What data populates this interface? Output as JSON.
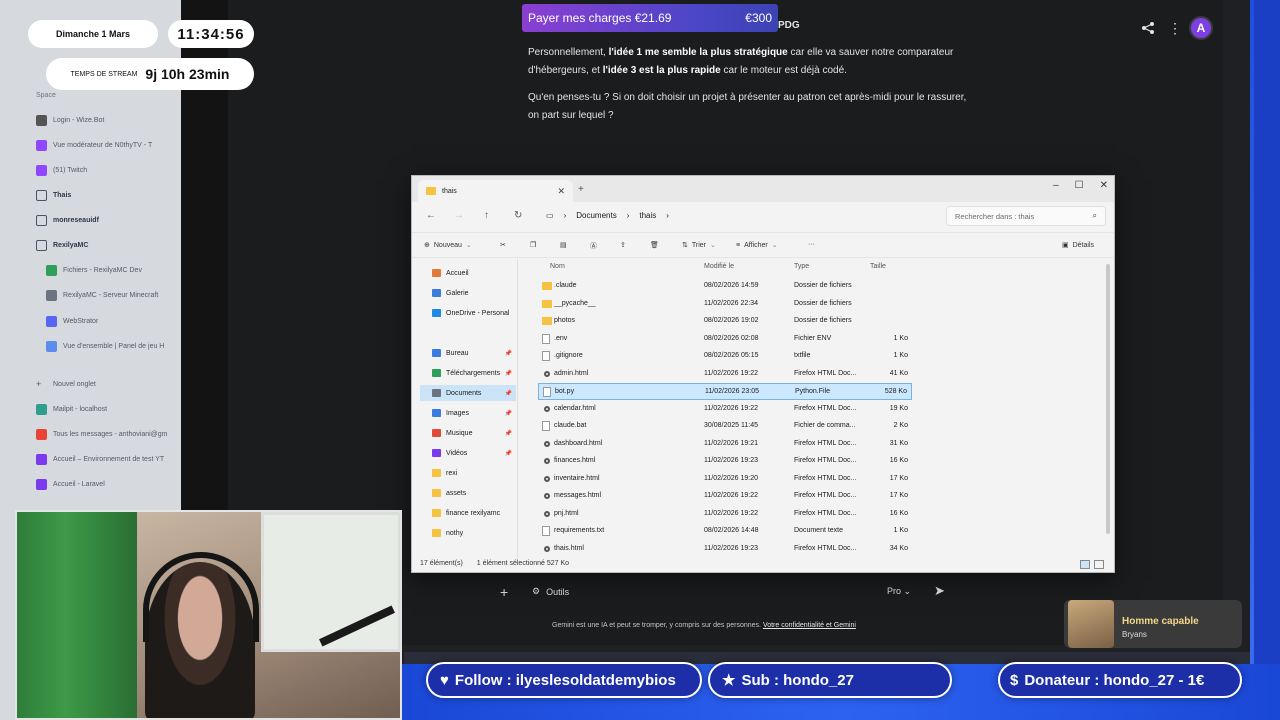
{
  "overlay": {
    "date": "Dimanche 1 Mars",
    "time": "11:34:56",
    "stream_label": "TEMPS DE STREAM",
    "stream_value": "9j 10h 23min",
    "follow": "Follow : ilyeslesoldatdemybios",
    "sub": "Sub : hondo_27",
    "donateur": "Donateur : hondo_27 - 1€",
    "alert_title": "Homme capable",
    "alert_user": "Bryans"
  },
  "donation": {
    "label": "Payer mes charges €21.69",
    "goal": "€300"
  },
  "sidebar": {
    "space_label": "Space",
    "items": [
      {
        "label": "Login - Wize.Bot",
        "color": "#555555"
      },
      {
        "label": "Vue modérateur de N0thyTV - T",
        "color": "#9146ff"
      },
      {
        "label": "(51) Twitch",
        "color": "#9146ff"
      },
      {
        "label": "Thais",
        "color": ""
      },
      {
        "label": "monreseauidf",
        "color": ""
      },
      {
        "label": "RexilyaMC",
        "color": ""
      },
      {
        "label": "Fichiers - RexilyaMC Dev",
        "color": "#2e9e58"
      },
      {
        "label": "RexilyaMC - Serveur Minecraft",
        "color": "#6b7280"
      },
      {
        "label": "WebStrator",
        "color": "#5865f2"
      },
      {
        "label": "Vue d'ensemble | Panel de jeu H",
        "color": "#5b8def"
      },
      {
        "label": "Nouvel onglet",
        "color": ""
      },
      {
        "label": "Mailpit - localhost",
        "color": "#2f9e8f"
      },
      {
        "label": "Tous les messages - anthoviani@gm",
        "color": "#ea4335"
      },
      {
        "label": "Accueil – Environnement de test YT",
        "color": "#7c3aed"
      },
      {
        "label": "Accueil - Laravel",
        "color": "#7c3aed"
      }
    ]
  },
  "gemini": {
    "header_suffix": "PDG",
    "paragraph1_pre": "Personnellement, ",
    "paragraph1_b1": "l'idée 1 me semble la plus stratégique",
    "paragraph1_mid": " car elle va sauver notre comparateur d'hébergeurs, et ",
    "paragraph1_b2": "l'idée 3 est la plus rapide",
    "paragraph1_post": " car le moteur est déjà codé.",
    "paragraph2": "Qu'en penses-tu ? Si on doit choisir un projet à présenter au patron cet après-midi pour le rassurer, on part sur lequel ?",
    "tools_label": "Outils",
    "mode_label": "Pro",
    "avatar_letter": "A",
    "disclaimer_pre": "Gemini est une IA et peut se tromper, y compris sur des personnes. ",
    "disclaimer_link": "Votre confidentialité et Gemini"
  },
  "explorer": {
    "tab_title": "thais",
    "breadcrumb": [
      "Documents",
      "thais"
    ],
    "search_placeholder": "Rechercher dans : thais",
    "toolbar": {
      "new": "Nouveau",
      "sort": "Trier",
      "view": "Afficher",
      "details": "Détails"
    },
    "nav": [
      {
        "label": "Accueil",
        "color": "#e07a3a"
      },
      {
        "label": "Galerie",
        "color": "#3a7be0"
      },
      {
        "label": "OneDrive - Personal",
        "color": "#1e88e5"
      },
      {
        "label": "Bureau",
        "color": "#3a7be0"
      },
      {
        "label": "Téléchargements",
        "color": "#2e9e58"
      },
      {
        "label": "Documents",
        "color": "#6b7280"
      },
      {
        "label": "Images",
        "color": "#3a7be0"
      },
      {
        "label": "Musique",
        "color": "#e04a3a"
      },
      {
        "label": "Vidéos",
        "color": "#7c3aed"
      },
      {
        "label": "rexi",
        "color": "#f5c242"
      },
      {
        "label": "assets",
        "color": "#f5c242"
      },
      {
        "label": "finance rexilyamc",
        "color": "#f5c242"
      },
      {
        "label": "nothy",
        "color": "#f5c242"
      }
    ],
    "columns": {
      "name": "Nom",
      "modified": "Modifié le",
      "type": "Type",
      "size": "Taille"
    },
    "files": [
      {
        "name": ".claude",
        "modified": "08/02/2026 14:59",
        "type": "Dossier de fichiers",
        "size": "",
        "kind": "folder"
      },
      {
        "name": "__pycache__",
        "modified": "11/02/2026 22:34",
        "type": "Dossier de fichiers",
        "size": "",
        "kind": "folder"
      },
      {
        "name": "photos",
        "modified": "08/02/2026 19:02",
        "type": "Dossier de fichiers",
        "size": "",
        "kind": "folder"
      },
      {
        "name": ".env",
        "modified": "08/02/2026 02:08",
        "type": "Fichier ENV",
        "size": "1 Ko",
        "kind": "file"
      },
      {
        "name": ".gitignore",
        "modified": "08/02/2026 05:15",
        "type": "txtfile",
        "size": "1 Ko",
        "kind": "file"
      },
      {
        "name": "admin.html",
        "modified": "11/02/2026 19:22",
        "type": "Firefox HTML Doc...",
        "size": "41 Ko",
        "kind": "html"
      },
      {
        "name": "bot.py",
        "modified": "11/02/2026 23:05",
        "type": "Python.File",
        "size": "528 Ko",
        "kind": "file"
      },
      {
        "name": "calendar.html",
        "modified": "11/02/2026 19:22",
        "type": "Firefox HTML Doc...",
        "size": "19 Ko",
        "kind": "html"
      },
      {
        "name": "claude.bat",
        "modified": "30/08/2025 11:45",
        "type": "Fichier de comma...",
        "size": "2 Ko",
        "kind": "file"
      },
      {
        "name": "dashboard.html",
        "modified": "11/02/2026 19:21",
        "type": "Firefox HTML Doc...",
        "size": "31 Ko",
        "kind": "html"
      },
      {
        "name": "finances.html",
        "modified": "11/02/2026 19:23",
        "type": "Firefox HTML Doc...",
        "size": "16 Ko",
        "kind": "html"
      },
      {
        "name": "inventaire.html",
        "modified": "11/02/2026 19:20",
        "type": "Firefox HTML Doc...",
        "size": "17 Ko",
        "kind": "html"
      },
      {
        "name": "messages.html",
        "modified": "11/02/2026 19:22",
        "type": "Firefox HTML Doc...",
        "size": "17 Ko",
        "kind": "html"
      },
      {
        "name": "pnj.html",
        "modified": "11/02/2026 19:22",
        "type": "Firefox HTML Doc...",
        "size": "16 Ko",
        "kind": "html"
      },
      {
        "name": "requirements.txt",
        "modified": "08/02/2026 14:48",
        "type": "Document texte",
        "size": "1 Ko",
        "kind": "file"
      },
      {
        "name": "thais.html",
        "modified": "11/02/2026 19:23",
        "type": "Firefox HTML Doc...",
        "size": "34 Ko",
        "kind": "html"
      }
    ],
    "selected_index": 6,
    "status_count": "17 élément(s)",
    "status_selected": "1 élément sélectionné  527 Ko"
  }
}
